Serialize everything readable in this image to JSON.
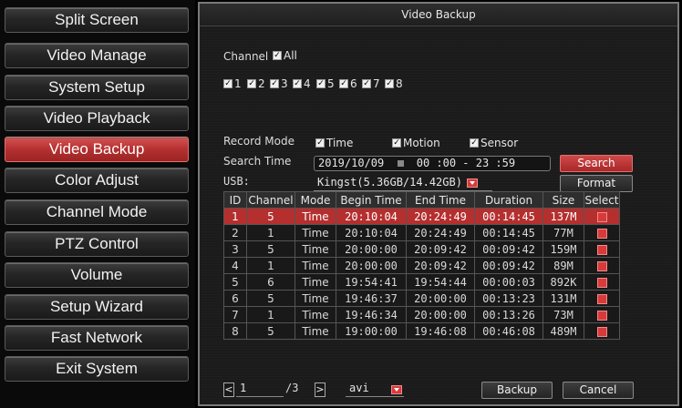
{
  "menu": {
    "items": [
      {
        "label": "Split Screen"
      },
      {
        "label": "Video Manage"
      },
      {
        "label": "System Setup"
      },
      {
        "label": "Video Playback"
      },
      {
        "label": "Video Backup"
      },
      {
        "label": "Color Adjust"
      },
      {
        "label": "Channel Mode"
      },
      {
        "label": "PTZ Control"
      },
      {
        "label": "Volume"
      },
      {
        "label": "Setup Wizard"
      },
      {
        "label": "Fast Network"
      },
      {
        "label": "Exit System"
      }
    ],
    "active_index": 4
  },
  "dialog": {
    "title": "Video Backup",
    "channel_label": "Channel",
    "all_label": "All",
    "channels": [
      "1",
      "2",
      "3",
      "4",
      "5",
      "6",
      "7",
      "8"
    ],
    "record_mode_label": "Record Mode",
    "modes": [
      "Time",
      "Motion",
      "Sensor"
    ],
    "search_time_label": "Search Time",
    "search_date": "2019/10/09",
    "search_time_range": "00 :00 - 23 :59",
    "usb_label": "USB:",
    "usb_value": "Kingst(5.36GB/14.42GB)",
    "search_button": "Search",
    "format_button": "Format",
    "backup_button": "Backup",
    "cancel_button": "Cancel",
    "page_current": "1",
    "page_total": "/3",
    "prev_glyph": "<",
    "next_glyph": ">",
    "format_value": "avi",
    "check_glyph": "✓"
  },
  "table": {
    "headers": [
      "ID",
      "Channel",
      "Mode",
      "Begin Time",
      "End Time",
      "Duration",
      "Size",
      "Select"
    ],
    "rows": [
      [
        "1",
        "5",
        "Time",
        "20:10:04",
        "20:24:49",
        "00:14:45",
        "137M"
      ],
      [
        "2",
        "1",
        "Time",
        "20:10:04",
        "20:24:49",
        "00:14:45",
        "77M"
      ],
      [
        "3",
        "5",
        "Time",
        "20:00:00",
        "20:09:42",
        "00:09:42",
        "159M"
      ],
      [
        "4",
        "1",
        "Time",
        "20:00:00",
        "20:09:42",
        "00:09:42",
        "89M"
      ],
      [
        "5",
        "6",
        "Time",
        "19:54:41",
        "19:54:44",
        "00:00:03",
        "892K"
      ],
      [
        "6",
        "5",
        "Time",
        "19:46:37",
        "20:00:00",
        "00:13:23",
        "131M"
      ],
      [
        "7",
        "1",
        "Time",
        "19:46:34",
        "20:00:00",
        "00:13:26",
        "73M"
      ],
      [
        "8",
        "5",
        "Time",
        "19:00:00",
        "19:46:08",
        "00:46:08",
        "489M"
      ]
    ],
    "selected_row": 0
  },
  "colors": {
    "accent_red": "#b52f2f",
    "panel_bg": "#1b1b1b"
  }
}
